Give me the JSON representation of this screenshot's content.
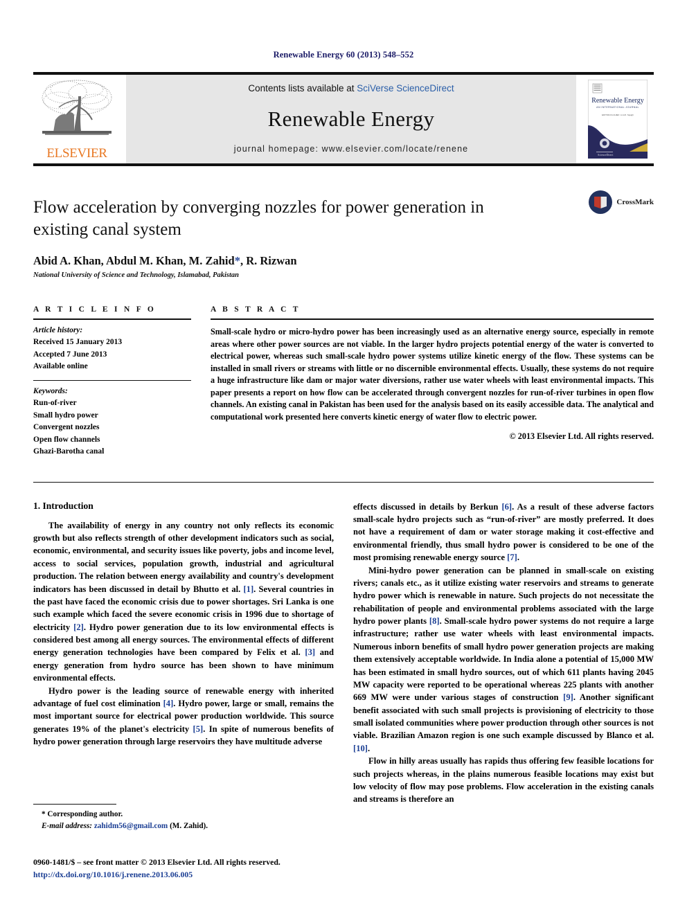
{
  "running_head": "Renewable Energy 60 (2013) 548–552",
  "masthead": {
    "elsevier_wordmark": "ELSEVIER",
    "contents_prefix": "Contents lists available at ",
    "contents_link": "SciVerse ScienceDirect",
    "journal_title": "Renewable Energy",
    "homepage": "journal homepage: www.elsevier.com/locate/renene",
    "cover": {
      "title": "Renewable Energy",
      "subtitle": "AN INTERNATIONAL JOURNAL",
      "editors": "EDITOR-IN-CHIEF: A.A.M. Sayigh"
    }
  },
  "article": {
    "title": "Flow acceleration by converging nozzles for power generation in existing canal system",
    "authors": "Abid A. Khan, Abdul M. Khan, M. Zahid",
    "authors_star": "*",
    "authors_tail": ", R. Rizwan",
    "affiliation": "National University of Science and Technology, Islamabad, Pakistan",
    "crossmark_label": "CrossMark"
  },
  "article_info": {
    "heading": "A R T I C L E   I N F O",
    "history_label": "Article history:",
    "history": [
      "Received 15 January 2013",
      "Accepted 7 June 2013",
      "Available online"
    ],
    "keywords_label": "Keywords:",
    "keywords": [
      "Run-of-river",
      "Small hydro power",
      "Convergent nozzles",
      "Open flow channels",
      "Ghazi-Barotha canal"
    ]
  },
  "abstract": {
    "heading": "A B S T R A C T",
    "text": "Small-scale hydro or micro-hydro power has been increasingly used as an alternative energy source, especially in remote areas where other power sources are not viable. In the larger hydro projects potential energy of the water is converted to electrical power, whereas such small-scale hydro power systems utilize kinetic energy of the flow. These systems can be installed in small rivers or streams with little or no discernible environmental effects. Usually, these systems do not require a huge infrastructure like dam or major water diversions, rather use water wheels with least environmental impacts. This paper presents a report on how flow can be accelerated through convergent nozzles for run-of-river turbines in open flow channels. An existing canal in Pakistan has been used for the analysis based on its easily accessible data. The analytical and computational work presented here converts kinetic energy of water flow to electric power.",
    "copyright": "© 2013 Elsevier Ltd. All rights reserved."
  },
  "introduction": {
    "section_title": "1. Introduction",
    "left_paragraphs": [
      "The availability of energy in any country not only reflects its economic growth but also reflects strength of other development indicators such as social, economic, environmental, and security issues like poverty, jobs and income level, access to social services, population growth, industrial and agricultural production. The relation between energy availability and country's development indicators has been discussed in detail by Bhutto et al. [1]. Several countries in the past have faced the economic crisis due to power shortages. Sri Lanka is one such example which faced the severe economic crisis in 1996 due to shortage of electricity [2]. Hydro power generation due to its low environmental effects is considered best among all energy sources. The environmental effects of different energy generation technologies have been compared by Felix et al. [3] and energy generation from hydro source has been shown to have minimum environmental effects.",
      "Hydro power is the leading source of renewable energy with inherited advantage of fuel cost elimination [4]. Hydro power, large or small, remains the most important source for electrical power production worldwide. This source generates 19% of the planet's electricity [5]. In spite of numerous benefits of hydro power generation through large reservoirs they have multitude adverse"
    ],
    "right_paragraphs": [
      "effects discussed in details by Berkun [6]. As a result of these adverse factors small-scale hydro projects such as “run-of-river” are mostly preferred. It does not have a requirement of dam or water storage making it cost-effective and environmental friendly, thus small hydro power is considered to be one of the most promising renewable energy source [7].",
      "Mini-hydro power generation can be planned in small-scale on existing rivers; canals etc., as it utilize existing water reservoirs and streams to generate hydro power which is renewable in nature. Such projects do not necessitate the rehabilitation of people and environmental problems associated with the large hydro power plants [8]. Small-scale hydro power systems do not require a large infrastructure; rather use water wheels with least environmental impacts. Numerous inborn benefits of small hydro power generation projects are making them extensively acceptable worldwide. In India alone a potential of 15,000 MW has been estimated in small hydro sources, out of which 611 plants having 2045 MW capacity were reported to be operational whereas 225 plants with another 669 MW were under various stages of construction [9]. Another significant benefit associated with such small projects is provisioning of electricity to those small isolated communities where power production through other sources is not viable. Brazilian Amazon region is one such example discussed by Blanco et al. [10].",
      "Flow in hilly areas usually has rapids thus offering few feasible locations for such projects whereas, in the plains numerous feasible locations may exist but low velocity of flow may pose problems. Flow acceleration in the existing canals and streams is therefore an"
    ]
  },
  "footnote": {
    "corresponding": "* Corresponding author.",
    "email_label": "E-mail address:",
    "email": "zahidm56@gmail.com",
    "email_suffix": " (M. Zahid)."
  },
  "imprint": {
    "line1": "0960-1481/$ – see front matter © 2013 Elsevier Ltd. All rights reserved.",
    "doi": "http://dx.doi.org/10.1016/j.renene.2013.06.005"
  },
  "colors": {
    "running_head": "#1a1a66",
    "link": "#2b5fa8",
    "reference": "#1c3f94",
    "elsevier_orange": "#E87722",
    "band_grey": "#e6e6e6",
    "crossmark_blue": "#22325e",
    "crossmark_red": "#c0392b"
  }
}
